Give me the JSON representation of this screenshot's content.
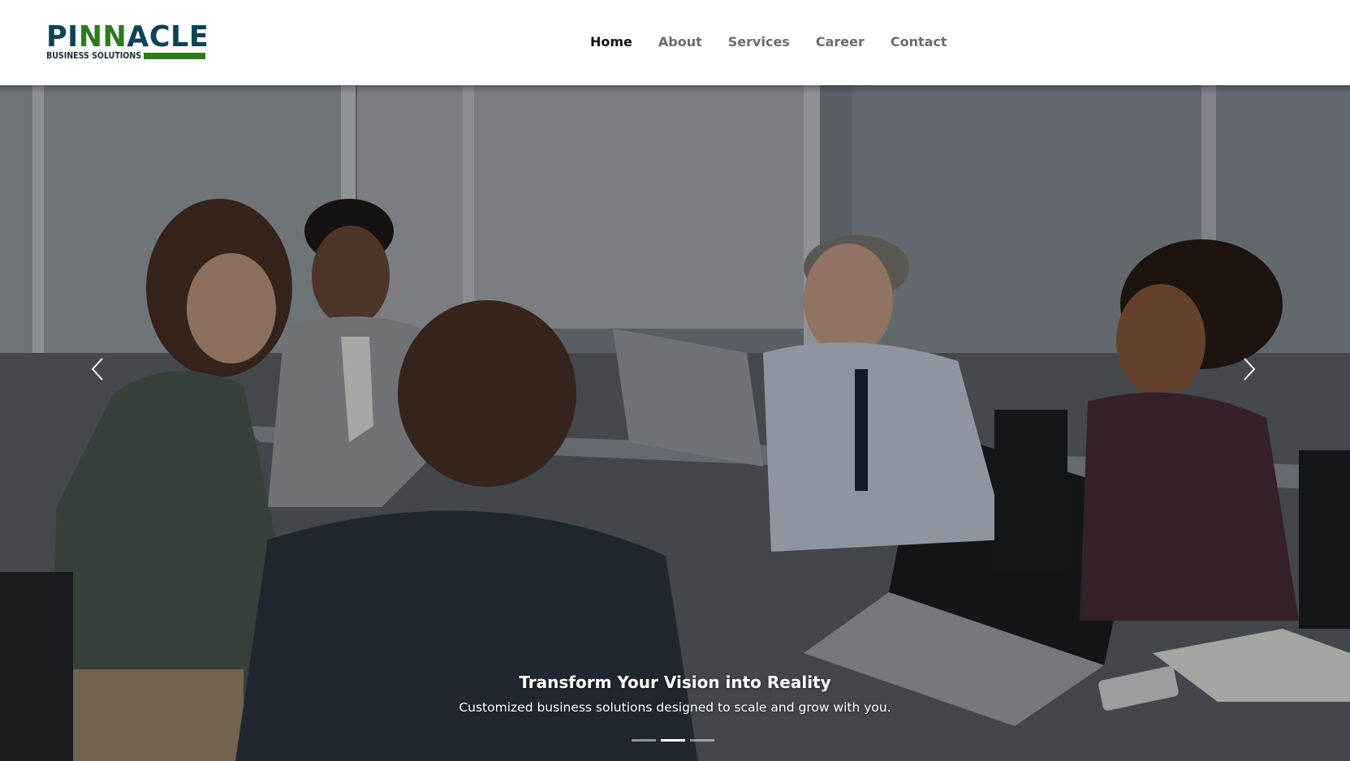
{
  "brand": {
    "name_part1": "PI",
    "name_accent": "NN",
    "name_part2": "ACLE",
    "tagline": "BUSINESS SOLUTIONS",
    "colors": {
      "primary": "#0f4257",
      "accent": "#2f7a1d"
    }
  },
  "nav": {
    "items": [
      {
        "label": "Home",
        "active": true
      },
      {
        "label": "About",
        "active": false
      },
      {
        "label": "Services",
        "active": false
      },
      {
        "label": "Career",
        "active": false
      },
      {
        "label": "Contact",
        "active": false
      }
    ]
  },
  "hero": {
    "image_subject": "business-team-meeting-photo",
    "title": "Transform Your Vision into Reality",
    "subtitle": "Customized business solutions designed to scale and grow with you.",
    "prev_icon": "chevron-left-icon",
    "next_icon": "chevron-right-icon",
    "slides_count": 3,
    "active_slide": 2
  }
}
